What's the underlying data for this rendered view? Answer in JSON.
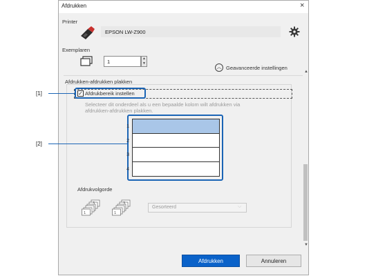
{
  "window": {
    "title": "Afdrukken",
    "close_glyph": "×"
  },
  "printer": {
    "label": "Printer",
    "name": "EPSON LW-Z900",
    "icon": "printer-icon",
    "settings_icon": "gear-icon"
  },
  "copies": {
    "label": "Exemplaren",
    "value": "1"
  },
  "advanced": {
    "label": "Geavanceerde instellingen"
  },
  "paste_section": {
    "title": "Afdrukken-afdrukken plakken",
    "checkbox_label": "Afdrukbereik instellen",
    "checkbox_mark": "✓",
    "hint_line1": "Selecteer dit onderdeel als u een bepaalde kolom wilt afdrukken via",
    "hint_line2": "afdrukken-afdrukken plakken.",
    "columns": [
      "1",
      "2",
      "3",
      "4"
    ]
  },
  "print_order": {
    "label": "Afdrukvolgorde",
    "selected": "Gesorteerd"
  },
  "buttons": {
    "print": "Afdrukken",
    "cancel": "Annuleren"
  },
  "callouts": {
    "c1": "[1]",
    "c2": "[2]"
  },
  "colors": {
    "accent": "#0a62c9",
    "callout": "#1a64b5",
    "selected_cell": "#a9c6e8"
  }
}
